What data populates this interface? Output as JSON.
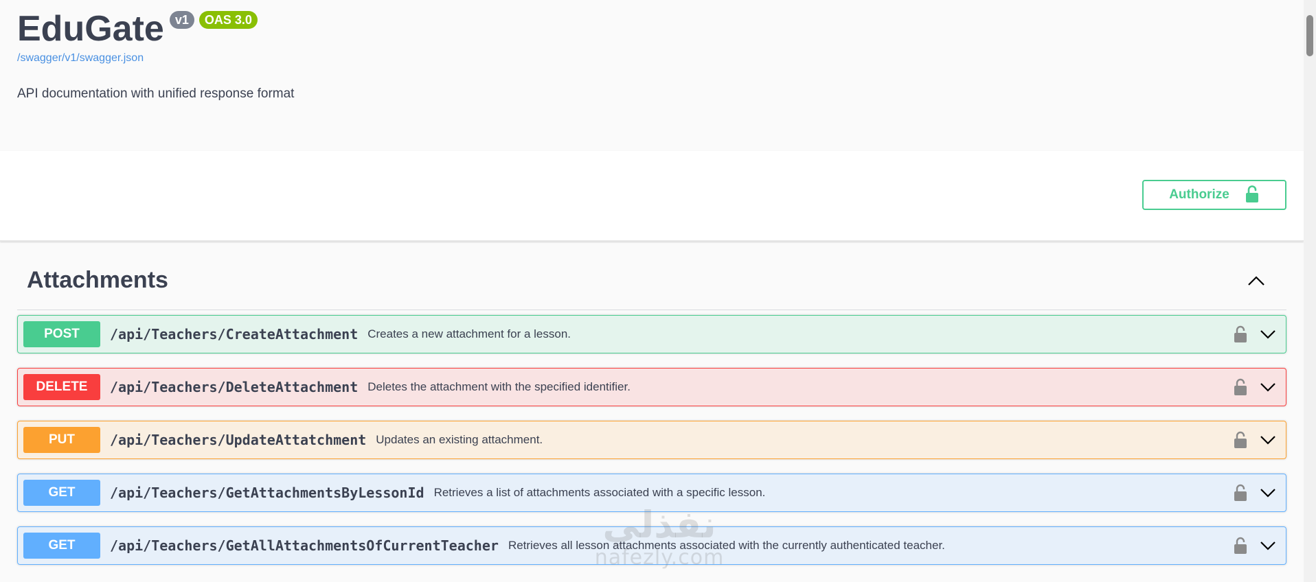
{
  "info": {
    "title": "EduGate",
    "version_badge": "v1",
    "oas_badge": "OAS 3.0",
    "spec_link": "/swagger/v1/swagger.json",
    "description": "API documentation with unified response format"
  },
  "scheme": {
    "authorize_label": "Authorize",
    "authorize_icon": "unlocked-lock-icon",
    "accent_color": "#49cc90"
  },
  "tag": {
    "name": "Attachments",
    "toggle_icon": "chevron-up-icon"
  },
  "operations": [
    {
      "method": "POST",
      "path": "/api/Teachers/CreateAttachment",
      "summary": "Creates a new attachment for a lesson.",
      "color": "#49cc90"
    },
    {
      "method": "DELETE",
      "path": "/api/Teachers/DeleteAttachment",
      "summary": "Deletes the attachment with the specified identifier.",
      "color": "#f93e3e"
    },
    {
      "method": "PUT",
      "path": "/api/Teachers/UpdateAttatchment",
      "summary": "Updates an existing attachment.",
      "color": "#fca130"
    },
    {
      "method": "GET",
      "path": "/api/Teachers/GetAttachmentsByLessonId",
      "summary": "Retrieves a list of attachments associated with a specific lesson.",
      "color": "#61affe"
    },
    {
      "method": "GET",
      "path": "/api/Teachers/GetAllAttachmentsOfCurrentTeacher",
      "summary": "Retrieves all lesson attachments associated with the currently authenticated teacher.",
      "color": "#61affe"
    }
  ],
  "watermark": {
    "arabic": "نفذلي",
    "latin": "nafezly.com"
  }
}
